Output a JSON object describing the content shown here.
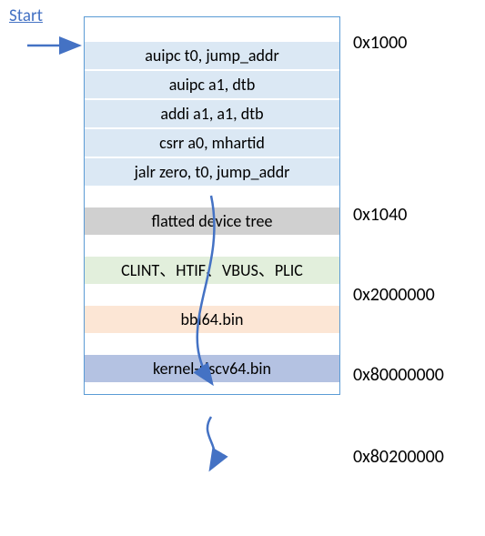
{
  "start_label": "Start",
  "instructions": [
    "auipc t0, jump_addr",
    "auipc a1, dtb",
    "addi a1, a1, dtb",
    "csrr a0, mhartid",
    "jalr zero, t0, jump_addr"
  ],
  "sections": {
    "fdt": "flatted device tree",
    "periph": "CLINT、HTIF、VBUS、PLIC",
    "bbl": "bbl64.bin",
    "kernel": "kernel-riscv64.bin"
  },
  "addresses": {
    "a0": "0x1000",
    "a1": "0x1040",
    "a2": "0x2000000",
    "a3": "0x80000000",
    "a4": "0x80200000"
  },
  "arrow_color": "#4472c4"
}
